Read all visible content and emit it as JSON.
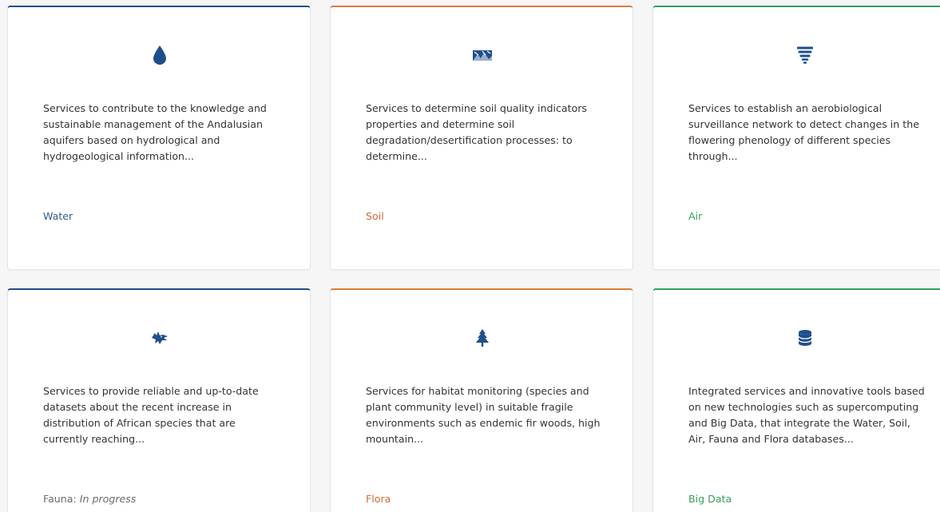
{
  "accent_colors": {
    "blue": "#1f4f8a",
    "orange": "#e07b3c",
    "green": "#34a05a"
  },
  "cards": [
    {
      "icon": "water-drop-icon",
      "description": "Services to contribute to the knowledge and sustainable management of the Andalusian aquifers based on hydrological and hydrogeological information...",
      "category": "Water",
      "category_color": "#2e5a8c"
    },
    {
      "icon": "soil-landscape-icon",
      "description": "Services to determine soil quality indicators properties and determine soil degradation/desertification processes: to determine...",
      "category": "Soil",
      "category_color": "#d06a3a"
    },
    {
      "icon": "tornado-icon",
      "description": "Services to establish an aerobiological surveillance network to detect changes in the flowering phenology of different species through...",
      "category": "Air",
      "category_color": "#34a05a"
    },
    {
      "icon": "wolf-head-icon",
      "description": "Services to provide reliable and up-to-date datasets about the recent increase in distribution of African species that are currently reaching...",
      "category": "Fauna:",
      "status": "In progress",
      "category_color": "#6b6b6b"
    },
    {
      "icon": "fir-tree-icon",
      "description": "Services for habitat monitoring (species and plant community level) in suitable fragile environments such as endemic fir woods, high mountain...",
      "category": "Flora",
      "category_color": "#d06a3a"
    },
    {
      "icon": "database-icon",
      "description": "Integrated services and innovative tools based on new technologies such as supercomputing and Big Data, that integrate the Water, Soil, Air, Fauna and Flora databases...",
      "category": "Big Data",
      "category_color": "#34a05a"
    }
  ]
}
